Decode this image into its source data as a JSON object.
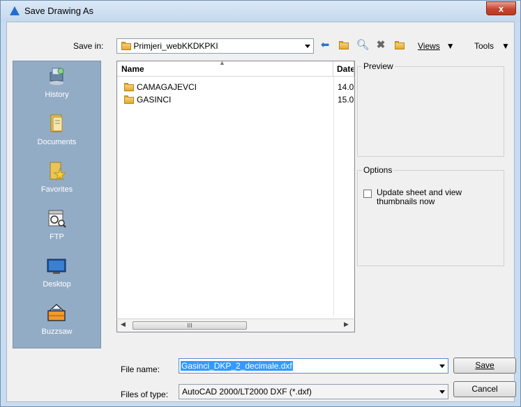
{
  "window": {
    "title": "Save Drawing As",
    "close_label": "x"
  },
  "toolbar": {
    "save_in_label": "Save in:",
    "save_in_value": "Primjeri_webKKDKPKI",
    "views_label": "Views",
    "tools_label": "Tools"
  },
  "places": [
    {
      "label": "History",
      "icon": "history-icon"
    },
    {
      "label": "Documents",
      "icon": "documents-icon"
    },
    {
      "label": "Favorites",
      "icon": "favorites-icon"
    },
    {
      "label": "FTP",
      "icon": "ftp-icon"
    },
    {
      "label": "Desktop",
      "icon": "desktop-icon"
    },
    {
      "label": "Buzzsaw",
      "icon": "buzzsaw-icon"
    }
  ],
  "filelist": {
    "columns": [
      "Name",
      "Date"
    ],
    "rows": [
      {
        "name": "CAMAGAJEVCI",
        "date": "14.0"
      },
      {
        "name": "GASINCI",
        "date": "15.0"
      }
    ],
    "scroll_grip": "III"
  },
  "preview": {
    "title": "Preview"
  },
  "options": {
    "title": "Options",
    "update_thumbnails_label": "Update sheet and view thumbnails now"
  },
  "form": {
    "file_name_label": "File name:",
    "file_name_value": "Gasinci_DKP_2_decimale.dxf",
    "file_type_label": "Files of type:",
    "file_type_value": "AutoCAD 2000/LT2000 DXF (*.dxf)"
  },
  "buttons": {
    "save": "Save",
    "cancel": "Cancel"
  },
  "colors": {
    "places_bg": "#93acc6",
    "selection": "#3399ff",
    "close": "#c7452f"
  }
}
